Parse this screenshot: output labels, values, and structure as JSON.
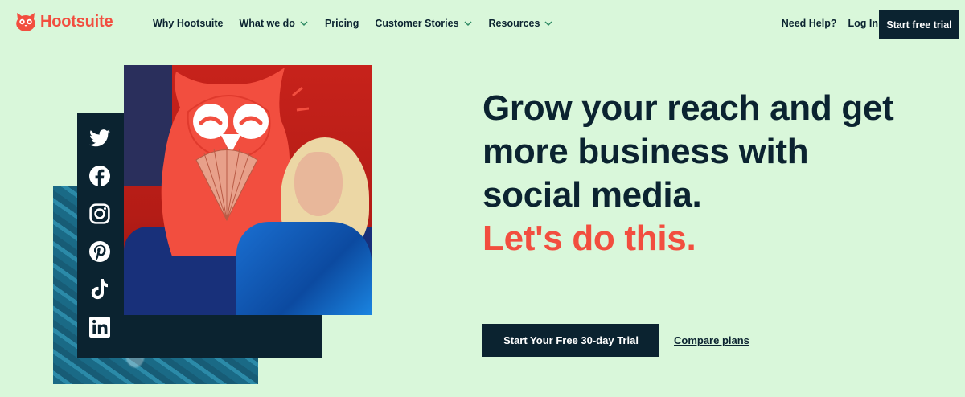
{
  "header": {
    "logo_text": "Hootsuite",
    "nav": [
      {
        "label": "Why Hootsuite",
        "dropdown": false
      },
      {
        "label": "What we do",
        "dropdown": true
      },
      {
        "label": "Pricing",
        "dropdown": false
      },
      {
        "label": "Customer Stories",
        "dropdown": true
      },
      {
        "label": "Resources",
        "dropdown": true
      }
    ],
    "need_help": "Need Help?",
    "login": "Log In",
    "start_trial": "Start free trial"
  },
  "hero": {
    "headline": "Grow your reach and get more business with social media.",
    "accent": "Let's do this.",
    "cta_label": "Start Your Free 30-day Trial",
    "compare_label": "Compare plans",
    "social_icons": [
      "twitter-icon",
      "facebook-icon",
      "instagram-icon",
      "pinterest-icon",
      "tiktok-icon",
      "linkedin-icon"
    ]
  },
  "colors": {
    "background": "#d9f7da",
    "navy": "#0b2330",
    "brand_red": "#f24e3f"
  }
}
